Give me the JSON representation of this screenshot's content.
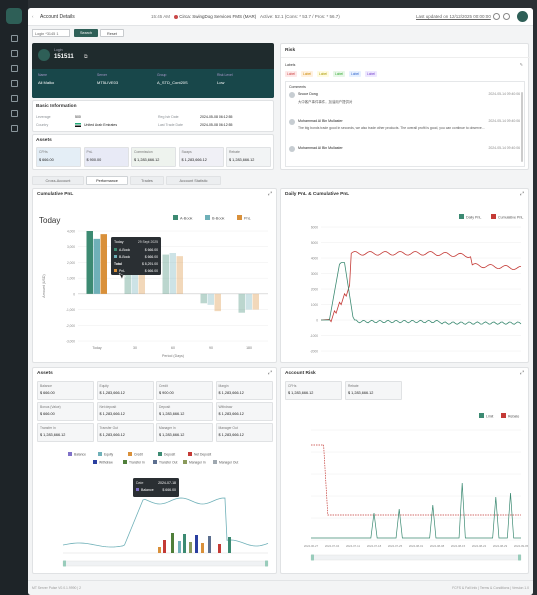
{
  "topbar": {
    "title": "Account Details",
    "time": "15:45 AM",
    "server": "Circa: SwingDog Services FMS (MAR)",
    "active": "Active: 52.1 (Cons: * 53.7 / Pros: * 56.7)",
    "updated": "Last updated on 12/12/2025 00:00:00"
  },
  "search": {
    "placeholder": "Login *3145 1",
    "search_label": "Search",
    "reset_label": "Reset"
  },
  "account": {
    "login_label": "Login",
    "login": "151511",
    "name_label": "Name",
    "name": "Ali Malko",
    "server_label": "Server",
    "server": "MT5LIVE03",
    "group_label": "Group",
    "group": "A_STD_Cont20S",
    "risk_label": "Risk Level",
    "risk": "Low"
  },
  "basic": {
    "title": "Basic Information",
    "leverage_label": "Leverage",
    "leverage": "500",
    "country_label": "Country",
    "country": "United Arab Emirates",
    "reg_label": "Reg Istr Date",
    "reg": "2024-05-08 06:12:55",
    "last_label": "Last Trade Date",
    "last": "2024-05-08 06:12:55"
  },
  "assets_top": {
    "title": "Assets",
    "tiles": [
      {
        "label": "CFHs",
        "value": "$ 666.00"
      },
      {
        "label": "PnL",
        "value": "$ 900.00"
      },
      {
        "label": "Commission",
        "value": "$ 1,283,666.12"
      },
      {
        "label": "Swaps",
        "value": "$ 1,283,666.12"
      },
      {
        "label": "Rebate",
        "value": "$ 1,283,666.12"
      }
    ]
  },
  "risk": {
    "title": "Risk",
    "labels_title": "Labels",
    "labels": [
      "Label",
      "Label",
      "Label",
      "Label",
      "Label",
      "Label"
    ],
    "comments_title": "Comments",
    "comments": [
      {
        "user": "Snoce Dong",
        "time": "2024-05-14 09:40:06",
        "text": "大中客户事件事件，加油用户提供对"
      },
      {
        "user": "Mohammad Al Bin Mullaster",
        "time": "2024-05-14 09:40:06",
        "text": "The big bonds trade good in seconds, we also trade other products. The overall profit is good, you can continue to observe..."
      },
      {
        "user": "Mohammad Al Bin Mullaster",
        "time": "2024-05-14 09:40:06",
        "text": ""
      }
    ]
  },
  "tabs": [
    "Cross-Account",
    "Performance",
    "Trades",
    "Account Statistic"
  ],
  "cumulative": {
    "title": "Cumulative PnL",
    "today": "Today",
    "legend": [
      "A-Book",
      "B-Book",
      "PnL"
    ],
    "xlabel": "Period (Days)",
    "ylabel": "Amount (USD)",
    "tooltip": {
      "title": "Today",
      "date": "29 Sept 2025",
      "rows": [
        [
          "A-Book",
          "$ 666.00"
        ],
        [
          "B-Book",
          "$ 666.00"
        ],
        [
          "Total",
          "$ 8,291.00"
        ],
        [
          "PnL",
          "$ 666.00"
        ]
      ]
    }
  },
  "daily": {
    "title": "Daily PnL & Cumulative PnL",
    "legend": [
      "Daily PnL",
      "Cumulative PnL"
    ]
  },
  "assets_bottom": {
    "title": "Assets",
    "tiles": [
      {
        "label": "Balance",
        "value": "$ 666.00"
      },
      {
        "label": "Equity",
        "value": "$ 1,283,666.12"
      },
      {
        "label": "Credit",
        "value": "$ 900.00"
      },
      {
        "label": "Margin",
        "value": "$ 1,283,666.12"
      },
      {
        "label": "Bonus (Value)",
        "value": "$ 666.00"
      },
      {
        "label": "Net deposit",
        "value": "$ 1,283,666.12"
      },
      {
        "label": "Deposit",
        "value": "$ 1,283,666.12"
      },
      {
        "label": "Withdraw",
        "value": "$ 1,283,666.12"
      },
      {
        "label": "Transfer In",
        "value": "$ 1,283,666.12"
      },
      {
        "label": "Transfer Out",
        "value": "$ 1,283,666.12"
      },
      {
        "label": "Manager In",
        "value": "$ 1,283,666.12"
      },
      {
        "label": "Manager Out",
        "value": "$ 1,283,666.12"
      }
    ],
    "legend": [
      "Balance",
      "Equity",
      "Credit",
      "Deposit",
      "Net Deposit",
      "Withdraw",
      "Transfer In",
      "Transfer Out",
      "Manager In",
      "Manager Out"
    ],
    "tooltip": {
      "date_label": "Date",
      "date": "2024-07-18",
      "row_label": "Balance",
      "row_value": "$ 666.00"
    }
  },
  "account_risk": {
    "title": "Account Risk",
    "tiles": [
      {
        "label": "CFHs",
        "value": "$ 1,283,666.12"
      },
      {
        "label": "Rebate",
        "value": "$ 1,283,666.12"
      }
    ],
    "legend": [
      "Limit",
      "Rebate"
    ]
  },
  "footer": {
    "left": "MT Server Pulse V0.0.1.9990 | 2",
    "right": "FCFS & Fall Info | Terms & Conditions | Version 1.0"
  },
  "chart_data": [
    {
      "type": "bar",
      "title": "Cumulative PnL",
      "categories": [
        "Today",
        "30",
        "60",
        "90",
        "180"
      ],
      "series": [
        {
          "name": "A-Book",
          "values": [
            4000,
            2400,
            2500,
            -600,
            -1200
          ]
        },
        {
          "name": "B-Book",
          "values": [
            3500,
            2300,
            2600,
            -700,
            -1000
          ]
        },
        {
          "name": "PnL",
          "values": [
            3800,
            2200,
            2400,
            -1100,
            -1000
          ]
        }
      ],
      "ylim": [
        -3000,
        4000
      ],
      "xlabel": "Period (Days)",
      "ylabel": "Amount (USD)"
    },
    {
      "type": "line",
      "title": "Daily PnL & Cumulative PnL",
      "ylim": [
        -2000,
        6000
      ],
      "series": [
        {
          "name": "Daily PnL",
          "color": "#3c8a72"
        },
        {
          "name": "Cumulative PnL",
          "color": "#c43a36"
        }
      ]
    },
    {
      "type": "line",
      "title": "Account Risk",
      "series": [
        {
          "name": "Limit",
          "color": "#3c8a72"
        },
        {
          "name": "Rebate",
          "color": "#c43a36"
        }
      ],
      "x": [
        "2024-06-27",
        "2024-07-04",
        "2024-07-11",
        "2024-07-18",
        "2024-07-25",
        "2024-08-01",
        "2024-08-08",
        "2024-08-15",
        "2024-08-22",
        "2024-08-29",
        "2024-09-05"
      ]
    }
  ]
}
